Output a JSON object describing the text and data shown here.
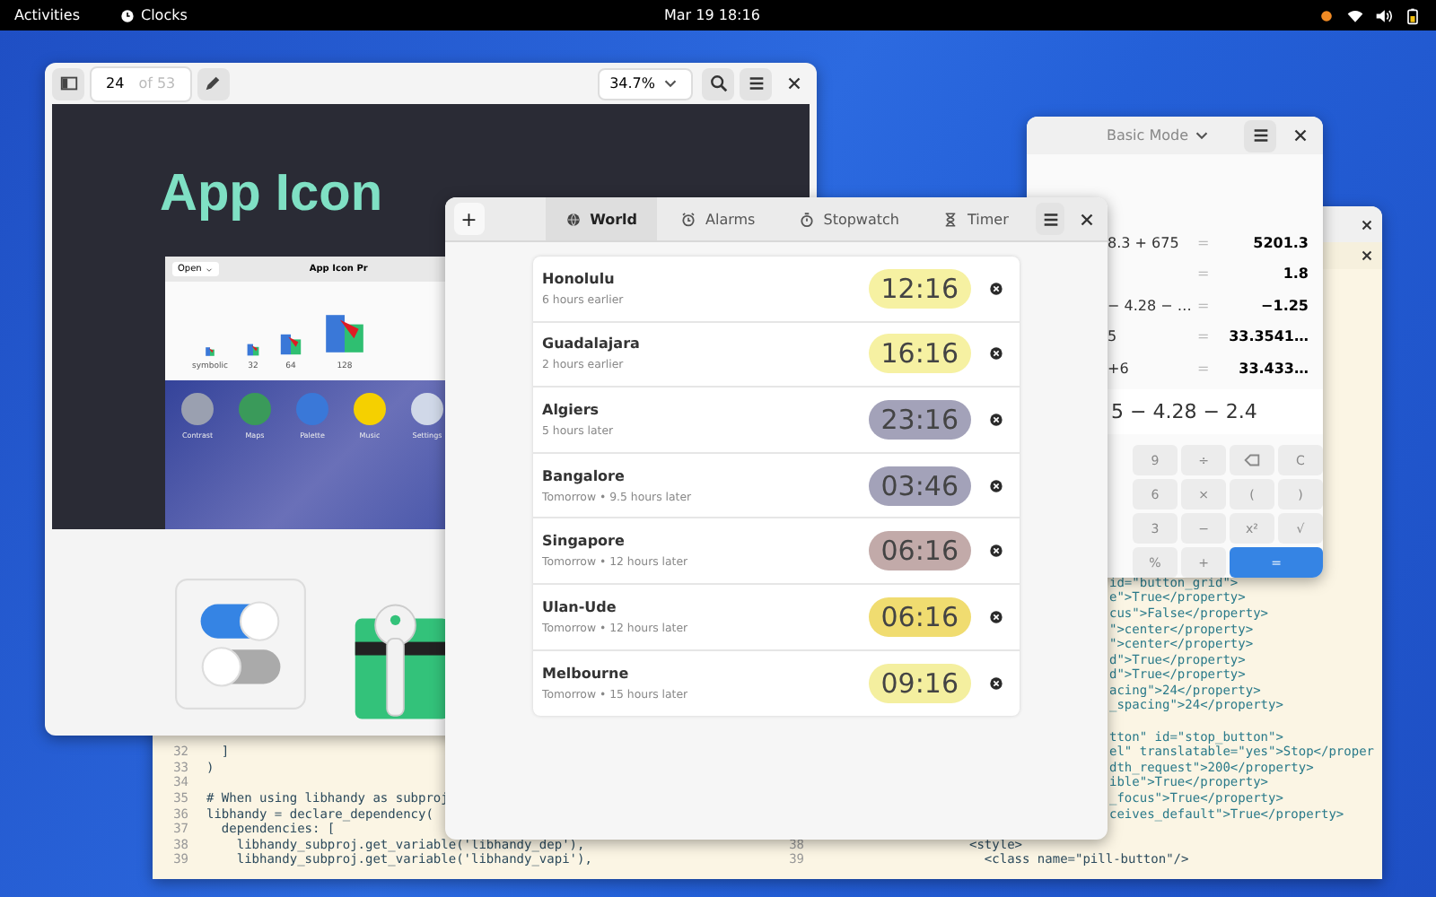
{
  "top_bar": {
    "activities": "Activities",
    "app_name": "Clocks",
    "clock": "Mar 19  18:16"
  },
  "document_viewer": {
    "page": "24",
    "page_total": "of 53",
    "zoom": "34.7%",
    "title": "App Icon",
    "inner_window": {
      "open_button": "Open",
      "title": "App Icon Pr",
      "size_labels": [
        "symbolic",
        "32",
        "64",
        "128"
      ],
      "app_labels": [
        "Contrast",
        "Maps",
        "Palette",
        "Music",
        "Settings"
      ]
    }
  },
  "text_editor": {
    "left_lines": [
      {
        "number": "32",
        "code": "  ]"
      },
      {
        "number": "33",
        "code": ")"
      },
      {
        "number": "34"
      },
      {
        "number": "35",
        "code": "# When using libhandy as subproj"
      },
      {
        "number": "36",
        "code": "libhandy = declare_dependency("
      },
      {
        "number": "37",
        "code": "  dependencies: ["
      },
      {
        "number": "38",
        "code": "    libhandy_subproj.get_variable('libhandy_dep'),"
      },
      {
        "number": "39",
        "code": "    libhandy_subproj.get_variable('libhandy_vapi'),"
      }
    ],
    "right_fragment_groups": [
      [
        "id=\"button_grid\">",
        "e\">True</property>",
        "cus\">False</property>",
        "\">center</property>",
        "\">center</property>",
        "d\">True</property>",
        "d\">True</property>",
        "acing\">24</property>",
        "_spacing\">24</property>"
      ],
      [
        "tton\" id=\"stop_button\">",
        "el\" translatable=\"yes\">Stop</proper",
        "dth_request\">200</property>",
        "ible\">True</property>",
        "_focus\">True</property>",
        "ceives_default\">True</property>"
      ]
    ],
    "right_lines": [
      {
        "number": "38",
        "code": "<style>"
      },
      {
        "number": "39",
        "code": "  <class name=\"pill-button\"/>"
      }
    ]
  },
  "calculator": {
    "mode": "Basic Mode",
    "history": [
      {
        "expression": "8.3 + 675",
        "equals": "=",
        "result": "5201.3"
      },
      {
        "equals": "=",
        "result": "1.8"
      },
      {
        "expression": "− 4.28 − …",
        "equals": "=",
        "result": "−1.25"
      },
      {
        "expression": "5",
        "equals": "=",
        "result": "33.3541…"
      },
      {
        "expression": "+6",
        "equals": "=",
        "result": "33.433…"
      }
    ],
    "entry": "5 − 4.28 − 2.4",
    "keys": [
      {
        "kind": "plain",
        "label": "9"
      },
      {
        "kind": "plain",
        "label": "÷"
      },
      {
        "kind": "backspace"
      },
      {
        "kind": "plain",
        "label": "C"
      },
      {
        "kind": "plain",
        "label": "6"
      },
      {
        "kind": "plain",
        "label": "×"
      },
      {
        "kind": "plain",
        "label": "("
      },
      {
        "kind": "plain",
        "label": ")"
      },
      {
        "kind": "plain",
        "label": "3"
      },
      {
        "kind": "plain",
        "label": "−"
      },
      {
        "kind": "power",
        "label": "x²"
      },
      {
        "kind": "plain",
        "label": "√"
      },
      {
        "kind": "plain",
        "label": "%"
      },
      {
        "kind": "plain",
        "label": "+"
      },
      {
        "kind": "equals",
        "label": "="
      }
    ]
  },
  "clocks": {
    "add_button": "+",
    "tabs": [
      {
        "kind": "world",
        "label": "World",
        "selected": true
      },
      {
        "kind": "alarms",
        "label": "Alarms",
        "selected": false
      },
      {
        "kind": "stopwatch",
        "label": "Stopwatch",
        "selected": false
      },
      {
        "kind": "timer",
        "label": "Timer",
        "selected": false
      }
    ],
    "cities": [
      {
        "name": "Honolulu",
        "offset": "6 hours earlier",
        "time": "12:16",
        "color": "#f6f1a2"
      },
      {
        "name": "Guadalajara",
        "offset": "2 hours earlier",
        "time": "16:16",
        "color": "#f6f1a2"
      },
      {
        "name": "Algiers",
        "offset": "5 hours later",
        "time": "23:16",
        "color": "#a3a2b9"
      },
      {
        "name": "Bangalore",
        "offset": "Tomorrow • 9.5 hours later",
        "time": "03:46",
        "color": "#a3a2b9"
      },
      {
        "name": "Singapore",
        "offset": "Tomorrow • 12 hours later",
        "time": "06:16",
        "color": "#c2aaa9"
      },
      {
        "name": "Ulan-Ude",
        "offset": "Tomorrow • 12 hours later",
        "time": "06:16",
        "color": "#f0dc70"
      },
      {
        "name": "Melbourne",
        "offset": "Tomorrow • 15 hours later",
        "time": "09:16",
        "color": "#f4ef9f"
      }
    ]
  }
}
